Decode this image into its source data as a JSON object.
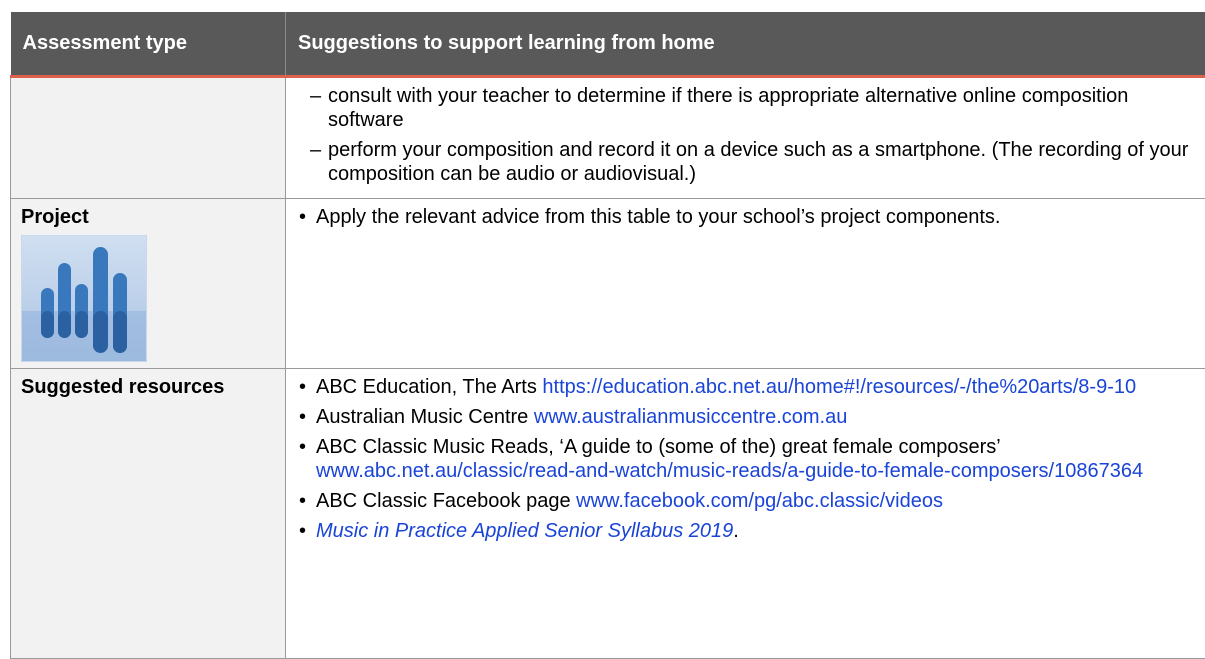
{
  "table": {
    "headers": {
      "col1": "Assessment type",
      "col2": "Suggestions to support learning from home"
    },
    "row1": {
      "type": "",
      "items": [
        "consult with your teacher to determine if there is appropriate alternative online composition software",
        "perform your composition and record it on a device such as a smartphone. (The recording of your composition can be audio or audiovisual.)"
      ]
    },
    "row2": {
      "type": "Project",
      "icon": "project-bars-icon",
      "items": [
        "Apply the relevant advice from this table to your school’s project components."
      ]
    },
    "row3": {
      "type": "Suggested resources",
      "resources": [
        {
          "text": "ABC Education, The Arts ",
          "link": "https://education.abc.net.au/home#!/resources/-/the%20arts/8-9-10"
        },
        {
          "text": "Australian Music Centre ",
          "link": "www.australianmusiccentre.com.au"
        },
        {
          "text": "ABC Classic Music Reads, ‘A guide to (some of the) great female composers’ ",
          "link": "www.abc.net.au/classic/read-and-watch/music-reads/a-guide-to-female-composers/10867364"
        },
        {
          "text": "ABC Classic Facebook page ",
          "link": "www.facebook.com/pg/abc.classic/videos"
        },
        {
          "text": "",
          "link": "Music in Practice Applied Senior Syllabus 2019",
          "suffix": "."
        }
      ]
    }
  },
  "colors": {
    "header_bg": "#595959",
    "header_rule": "#e0604e",
    "first_col_bg": "#f2f2f2",
    "link": "#1a44d8",
    "icon_bars": "#3a78be"
  }
}
